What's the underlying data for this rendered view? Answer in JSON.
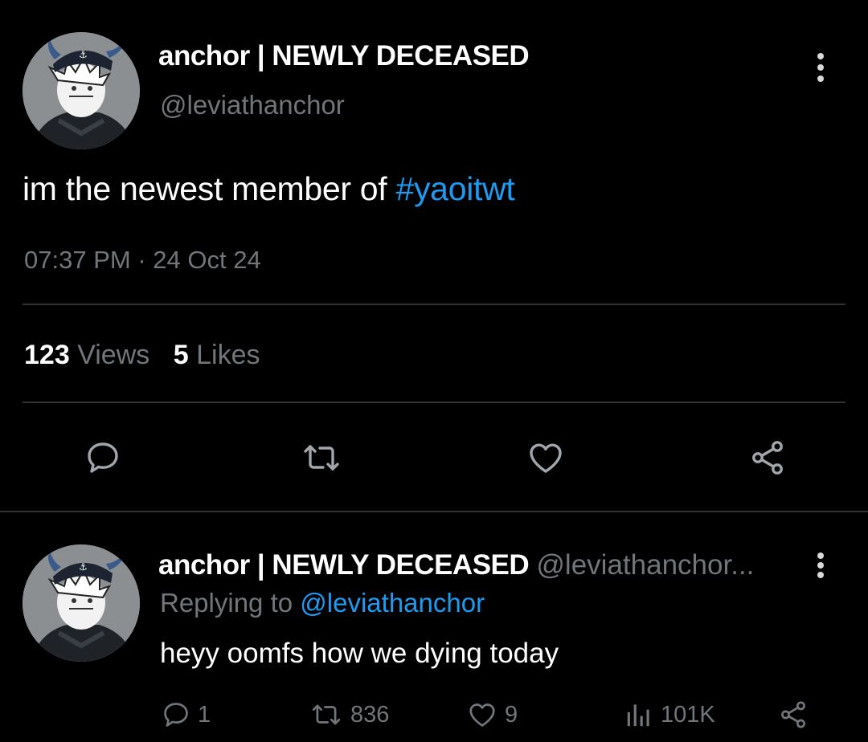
{
  "main_tweet": {
    "display_name": "anchor | NEWLY DECEASED",
    "handle": "@leviathanchor",
    "text_prefix": "im the newest member of ",
    "hashtag": "#yaoitwt",
    "time": "07:37 PM",
    "separator": "·",
    "date": "24 Oct 24",
    "views_count": "123",
    "views_label": "Views",
    "likes_count": "5",
    "likes_label": "Likes",
    "actions": [
      "reply-icon",
      "retweet-icon",
      "like-icon",
      "share-icon"
    ]
  },
  "reply_tweet": {
    "display_name": "anchor | NEWLY DECEASED",
    "handle_truncated": "@leviathanchor...",
    "replying_prefix": "Replying to",
    "replying_handle": "@leviathanchor",
    "text": "heyy oomfs how we dying today",
    "reply_count": "1",
    "retweet_count": "836",
    "like_count": "9",
    "views_count": "101K"
  },
  "colors": {
    "background": "#000000",
    "text": "#ffffff",
    "muted": "#71767b",
    "accent": "#1d9bf0",
    "divider": "#2f3336"
  }
}
